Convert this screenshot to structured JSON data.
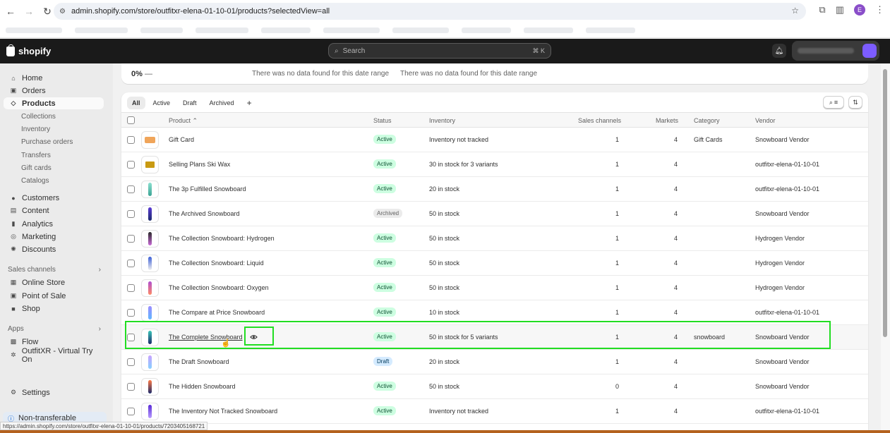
{
  "browser": {
    "url": "admin.shopify.com/store/outfitxr-elena-01-10-01/products?selectedView=all",
    "profile_initial": "E",
    "status_url": "https://admin.shopify.com/store/outfitxr-elena-01-10-01/products/7203405168721"
  },
  "topbar": {
    "brand": "shopify",
    "search_placeholder": "Search",
    "search_shortcut": "⌘ K"
  },
  "sidebar": {
    "items": [
      {
        "label": "Home",
        "icon": "home-icon"
      },
      {
        "label": "Orders",
        "icon": "orders-icon"
      },
      {
        "label": "Products",
        "icon": "tag-icon",
        "active": true
      }
    ],
    "product_subitems": [
      "Collections",
      "Inventory",
      "Purchase orders",
      "Transfers",
      "Gift cards",
      "Catalogs"
    ],
    "items2": [
      "Customers",
      "Content",
      "Analytics",
      "Marketing",
      "Discounts"
    ],
    "sales_channels_heading": "Sales channels",
    "sales_channels": [
      "Online Store",
      "Point of Sale",
      "Shop"
    ],
    "apps_heading": "Apps",
    "apps": [
      "Flow",
      "OutfitXR - Virtual Try On"
    ],
    "settings": "Settings",
    "non_transferable": "Non-transferable"
  },
  "stats": [
    {
      "value": "0%",
      "dash": "—"
    },
    {
      "value": "There was no data found for this date range"
    },
    {
      "value": "There was no data found for this date range"
    }
  ],
  "tabs": [
    "All",
    "Active",
    "Draft",
    "Archived",
    "+"
  ],
  "columns": {
    "product": "Product",
    "status": "Status",
    "inventory": "Inventory",
    "sales_channels": "Sales channels",
    "markets": "Markets",
    "category": "Category",
    "vendor": "Vendor"
  },
  "rows": [
    {
      "name": "Gift Card",
      "status": "Active",
      "inventory": "Inventory not tracked",
      "channels": "1",
      "markets": "4",
      "category": "Gift Cards",
      "vendor": "Snowboard Vendor"
    },
    {
      "name": "Selling Plans Ski Wax",
      "status": "Active",
      "inventory": "30 in stock for 3 variants",
      "channels": "1",
      "markets": "4",
      "category": "",
      "vendor": "outfitxr-elena-01-10-01"
    },
    {
      "name": "The 3p Fulfilled Snowboard",
      "status": "Active",
      "inventory": "20 in stock",
      "channels": "1",
      "markets": "4",
      "category": "",
      "vendor": "outfitxr-elena-01-10-01"
    },
    {
      "name": "The Archived Snowboard",
      "status": "Archived",
      "inventory": "50 in stock",
      "channels": "1",
      "markets": "4",
      "category": "",
      "vendor": "Snowboard Vendor"
    },
    {
      "name": "The Collection Snowboard: Hydrogen",
      "status": "Active",
      "inventory": "50 in stock",
      "channels": "1",
      "markets": "4",
      "category": "",
      "vendor": "Hydrogen Vendor"
    },
    {
      "name": "The Collection Snowboard: Liquid",
      "status": "Active",
      "inventory": "50 in stock",
      "channels": "1",
      "markets": "4",
      "category": "",
      "vendor": "Hydrogen Vendor"
    },
    {
      "name": "The Collection Snowboard: Oxygen",
      "status": "Active",
      "inventory": "50 in stock",
      "channels": "1",
      "markets": "4",
      "category": "",
      "vendor": "Hydrogen Vendor"
    },
    {
      "name": "The Compare at Price Snowboard",
      "status": "Active",
      "inventory": "10 in stock",
      "channels": "1",
      "markets": "4",
      "category": "",
      "vendor": "outfitxr-elena-01-10-01"
    },
    {
      "name": "The Complete Snowboard",
      "status": "Active",
      "inventory": "50 in stock for 5 variants",
      "channels": "1",
      "markets": "4",
      "category": "snowboard",
      "vendor": "Snowboard Vendor"
    },
    {
      "name": "The Draft Snowboard",
      "status": "Draft",
      "inventory": "20 in stock",
      "channels": "1",
      "markets": "4",
      "category": "",
      "vendor": "Snowboard Vendor"
    },
    {
      "name": "The Hidden Snowboard",
      "status": "Active",
      "inventory": "50 in stock",
      "channels": "0",
      "markets": "4",
      "category": "",
      "vendor": "Snowboard Vendor"
    },
    {
      "name": "The Inventory Not Tracked Snowboard",
      "status": "Active",
      "inventory": "Inventory not tracked",
      "channels": "1",
      "markets": "4",
      "category": "",
      "vendor": "outfitxr-elena-01-10-01"
    }
  ],
  "colors": {
    "accent_highlight": "#22dd22",
    "topbar": "#1a1a1a",
    "active_badge": "#cdfee1",
    "draft_badge": "#d5ebff"
  }
}
